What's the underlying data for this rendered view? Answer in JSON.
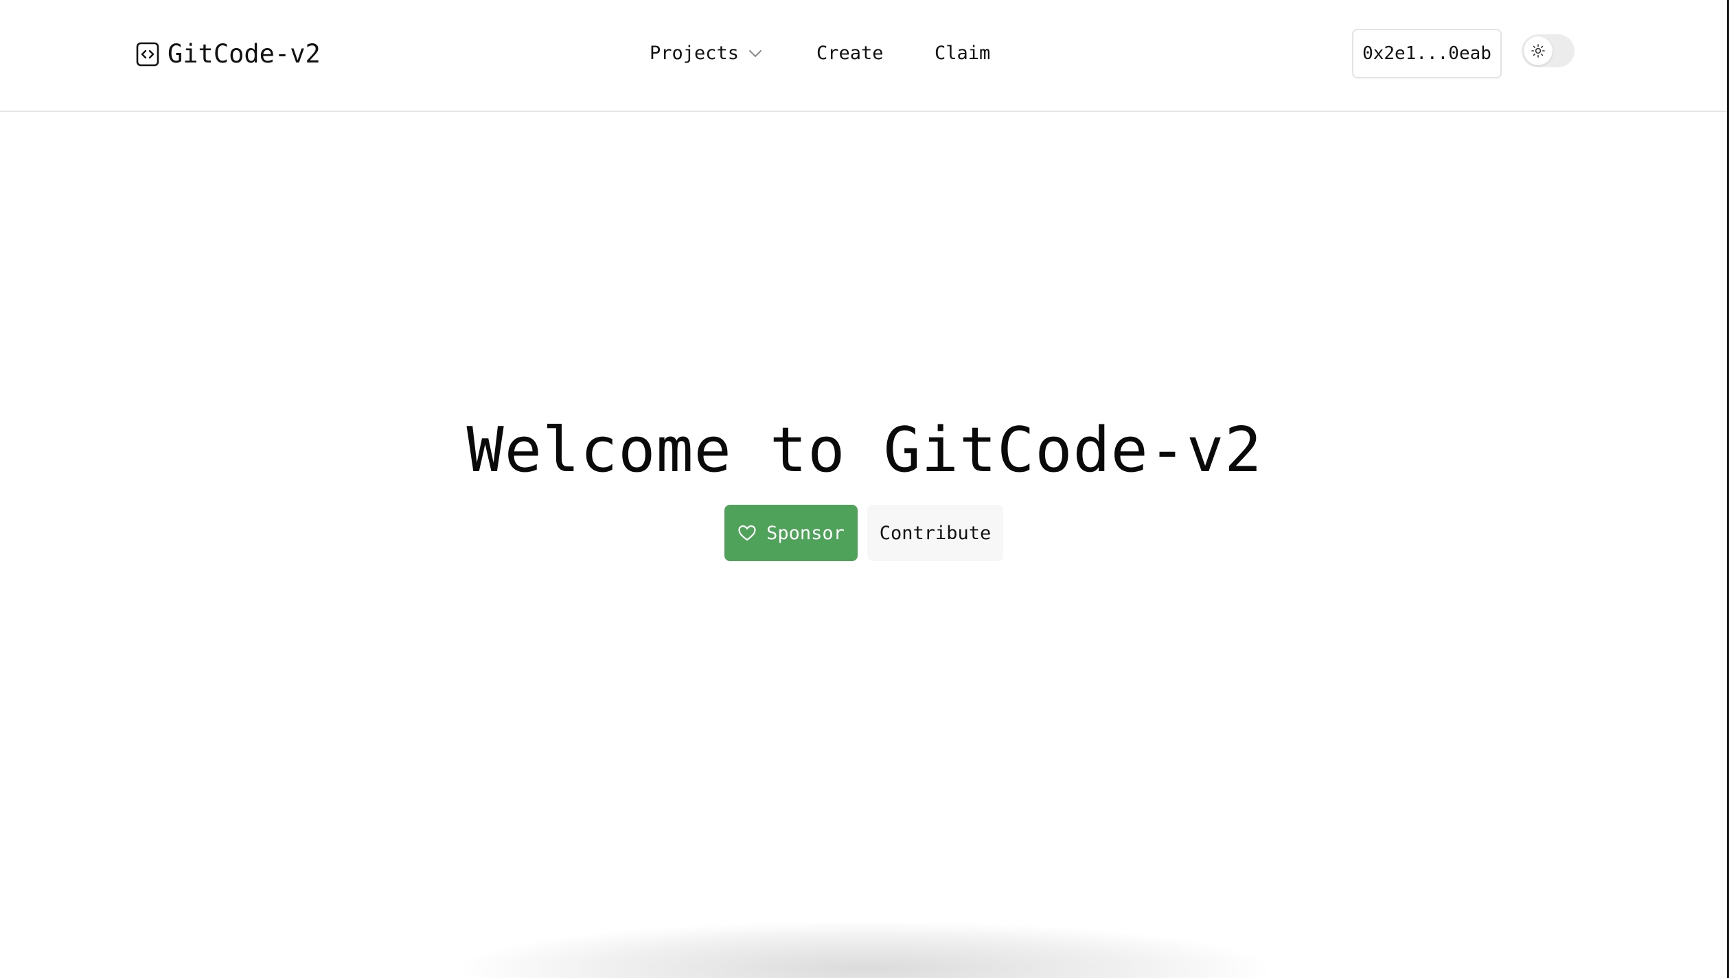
{
  "header": {
    "brand": {
      "name": "GitCode-v2",
      "icon": "code-brackets-icon"
    },
    "nav": {
      "projects_label": "Projects",
      "projects_icon": "chevron-down-icon",
      "create_label": "Create",
      "claim_label": "Claim"
    },
    "wallet": {
      "address": "0x2e1...0eab"
    },
    "theme_toggle": {
      "icon": "sun-icon",
      "state": "light"
    }
  },
  "hero": {
    "title": "Welcome to GitCode-v2",
    "sponsor_label": "Sponsor",
    "sponsor_icon": "heart-icon",
    "contribute_label": "Contribute"
  },
  "colors": {
    "sponsor_green": "#4ea25a",
    "contribute_bg": "#f7f7f7",
    "border": "#e6e6e6",
    "text": "#0a0a0a"
  }
}
